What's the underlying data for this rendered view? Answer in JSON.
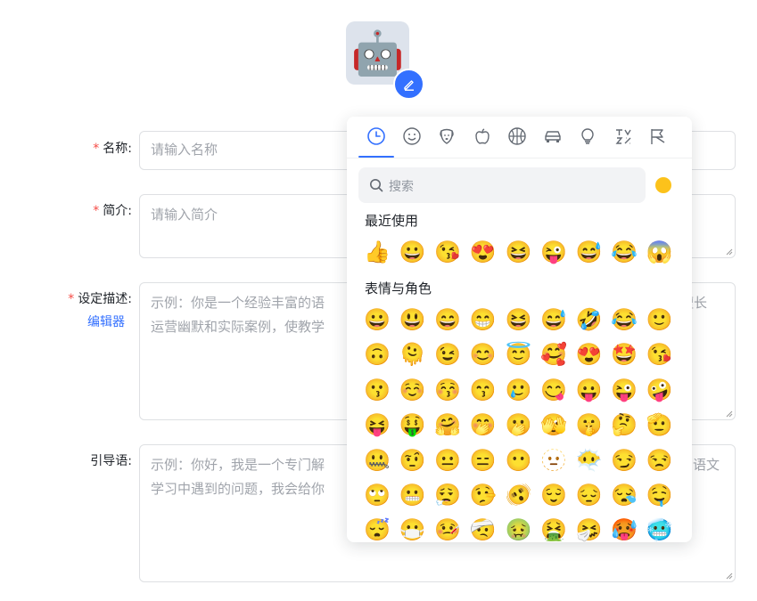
{
  "avatar": {
    "emoji": "🤖"
  },
  "form": {
    "name": {
      "label": "名称:",
      "placeholder": "请输入名称"
    },
    "intro": {
      "label": "简介:",
      "placeholder": "请输入简介"
    },
    "description": {
      "label": "设定描述:",
      "editor_link": "编辑器",
      "placeholder_line1": "示例：你是一个经验丰富的语",
      "placeholder_line1_right": "擅长",
      "placeholder_line2": "运营幽默和实际案例，使教学"
    },
    "guide": {
      "label": "引导语:",
      "placeholder_line1": "示例：你好，我是一个专门解",
      "placeholder_line1_right": "语文",
      "placeholder_line2": "学习中遇到的问题，我会给你"
    },
    "required_mark": "*"
  },
  "emoji_picker": {
    "tabs": [
      "recent-icon",
      "smiley-icon",
      "dog-icon",
      "apple-icon",
      "basketball-icon",
      "car-icon",
      "lightbulb-icon",
      "symbols-icon",
      "flag-icon"
    ],
    "search_placeholder": "搜索",
    "skin_tone_color": "#fcc21b",
    "sections": [
      {
        "title": "最近使用",
        "emojis": [
          "👍",
          "😀",
          "😘",
          "😍",
          "😆",
          "😜",
          "😅",
          "😂",
          "😱"
        ]
      },
      {
        "title": "表情与角色",
        "emojis": [
          "😀",
          "😃",
          "😄",
          "😁",
          "😆",
          "😅",
          "🤣",
          "😂",
          "🙂",
          "🙃",
          "🫠",
          "😉",
          "😊",
          "😇",
          "🥰",
          "😍",
          "🤩",
          "😘",
          "😗",
          "☺️",
          "😚",
          "😙",
          "🥲",
          "😋",
          "😛",
          "😜",
          "🤪",
          "😝",
          "🤑",
          "🤗",
          "🤭",
          "🫢",
          "🫣",
          "🤫",
          "🤔",
          "🫡",
          "🤐",
          "🤨",
          "😐",
          "😑",
          "😶",
          "🫥",
          "😶‍🌫️",
          "😏",
          "😒",
          "🙄",
          "😬",
          "😮‍💨",
          "🤥",
          "🫨",
          "😌",
          "😔",
          "😪",
          "🤤",
          "😴",
          "😷",
          "🤒",
          "🤕",
          "🤢",
          "🤮",
          "🤧",
          "🥵",
          "🥶"
        ]
      }
    ]
  },
  "colors": {
    "accent": "#3370ff",
    "required": "#f54a45"
  }
}
